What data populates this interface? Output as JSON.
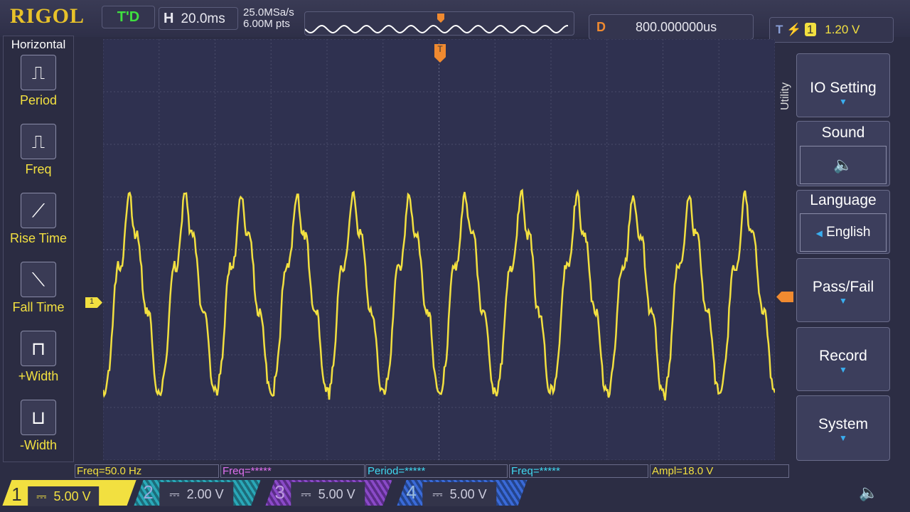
{
  "header": {
    "logo": "RIGOL",
    "trigger_status": "T'D",
    "h_label": "H",
    "timebase": "20.0ms",
    "sample_rate": "25.0MSa/s",
    "memory_depth": "6.00M pts",
    "delay_label": "D",
    "delay": "800.000000us",
    "trigger_label": "T",
    "trigger_source": "1",
    "trigger_level": "1.20 V"
  },
  "left_menu": {
    "title": "Horizontal",
    "items": [
      {
        "label": "Period",
        "icon": "period-icon"
      },
      {
        "label": "Freq",
        "icon": "freq-icon"
      },
      {
        "label": "Rise Time",
        "icon": "rise-time-icon"
      },
      {
        "label": "Fall Time",
        "icon": "fall-time-icon"
      },
      {
        "label": "+Width",
        "icon": "positive-width-icon"
      },
      {
        "label": "-Width",
        "icon": "negative-width-icon"
      }
    ]
  },
  "right_menu": {
    "title": "Utility",
    "io": "IO Setting",
    "sound": "Sound",
    "language": "Language",
    "language_value": "English",
    "passfail": "Pass/Fail",
    "record": "Record",
    "system": "System"
  },
  "markers": {
    "trigger": "T",
    "ch1": "1"
  },
  "measurements": [
    {
      "text": "Freq=50.0 Hz",
      "color": "#f2e040"
    },
    {
      "text": "Freq=*****",
      "color": "#e070f0"
    },
    {
      "text": "Period=*****",
      "color": "#40d8f0"
    },
    {
      "text": "Freq=*****",
      "color": "#40d8f0"
    },
    {
      "text": "Ampl=18.0 V",
      "color": "#f2e040"
    }
  ],
  "channels": [
    {
      "num": "1",
      "scale": "5.00 V",
      "color": "#f2e040"
    },
    {
      "num": "2",
      "scale": "2.00 V",
      "color": "#2aa8b8"
    },
    {
      "num": "3",
      "scale": "5.00 V",
      "color": "#8a4ac8"
    },
    {
      "num": "4",
      "scale": "5.00 V",
      "color": "#3a6ad8"
    }
  ],
  "colors": {
    "ch1": "#f2e040",
    "trigger": "#f08a30"
  }
}
